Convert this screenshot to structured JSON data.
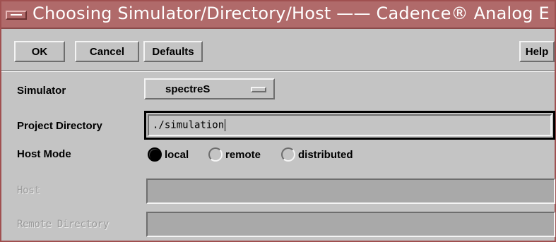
{
  "window": {
    "title": "Choosing Simulator/Directory/Host —— Cadence® Analog E"
  },
  "toolbar": {
    "ok": "OK",
    "cancel": "Cancel",
    "defaults": "Defaults",
    "help": "Help"
  },
  "form": {
    "simulator": {
      "label": "Simulator",
      "value": "spectreS"
    },
    "project_directory": {
      "label": "Project Directory",
      "value": "./simulation"
    },
    "host_mode": {
      "label": "Host Mode",
      "options": [
        "local",
        "remote",
        "distributed"
      ],
      "selected": "local"
    },
    "host": {
      "label": "Host",
      "value": ""
    },
    "remote_directory": {
      "label": "Remote Directory",
      "value": ""
    }
  }
}
